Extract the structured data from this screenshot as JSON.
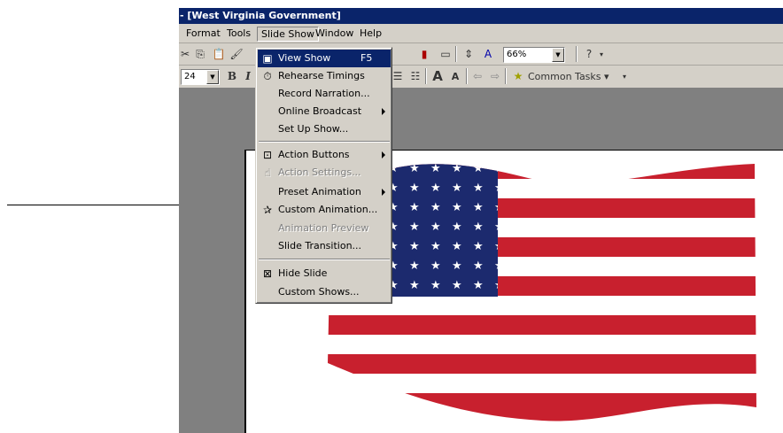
{
  "window": {
    "title": "- [West Virginia Government]"
  },
  "menubar": {
    "format": "Format",
    "tools": "Tools",
    "slide_show": "Slide Show",
    "window": "Window",
    "help": "Help"
  },
  "toolbar1": {
    "zoom": "66%"
  },
  "toolbar2": {
    "font_size": "24",
    "bold": "B",
    "italic": "I",
    "common_tasks": "Common Tasks"
  },
  "slide_show_menu": {
    "view_show": "View Show",
    "view_show_shortcut": "F5",
    "rehearse_timings": "Rehearse Timings",
    "record_narration": "Record Narration...",
    "online_broadcast": "Online Broadcast",
    "set_up_show": "Set Up Show...",
    "action_buttons": "Action Buttons",
    "action_settings": "Action Settings...",
    "preset_animation": "Preset Animation",
    "custom_animation": "Custom Animation...",
    "animation_preview": "Animation Preview",
    "slide_transition": "Slide Transition...",
    "hide_slide": "Hide Slide",
    "custom_shows": "Custom Shows..."
  },
  "colors": {
    "title_bar": "#0a246a",
    "highlight": "#0a246a",
    "menu_face": "#d4d0c8",
    "workspace": "#808080",
    "flag_red": "#c8202e",
    "flag_blue": "#1c2a6e"
  },
  "icons": {
    "view_show": "projector-icon",
    "rehearse_timings": "stopwatch-icon",
    "action_buttons": "action-button-icon",
    "action_settings": "hand-pointer-icon",
    "custom_animation": "animation-star-icon",
    "hide_slide": "hide-slide-icon"
  }
}
